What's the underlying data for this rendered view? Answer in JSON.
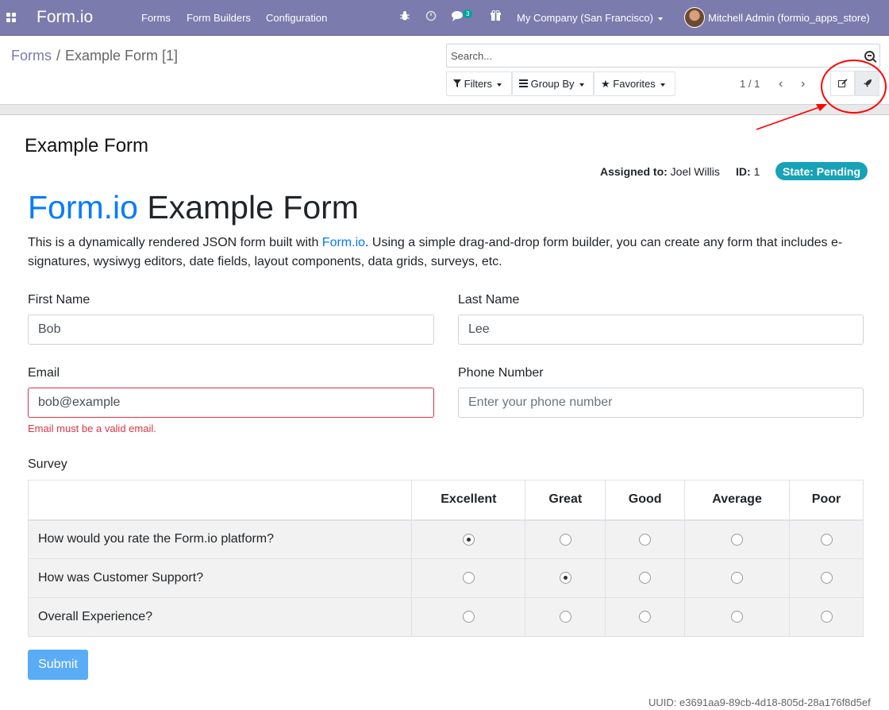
{
  "navbar": {
    "brand": "Form.io",
    "menu": [
      "Forms",
      "Form Builders",
      "Configuration"
    ],
    "messages_count": "3",
    "company": "My Company (San Francisco)",
    "user": "Mitchell Admin (formio_apps_store)",
    "bg_color": "#7c7bad"
  },
  "control_panel": {
    "breadcrumb": {
      "parent": "Forms",
      "current": "Example Form [1]"
    },
    "search": {
      "placeholder": "Search..."
    },
    "filters_label": "Filters",
    "groupby_label": "Group By",
    "favorites_label": "Favorites",
    "pager": "1 / 1"
  },
  "record": {
    "title": "Example Form",
    "assigned_label": "Assigned to:",
    "assigned_value": "Joel Willis",
    "id_label": "ID:",
    "id_value": "1",
    "state": "State: Pending",
    "state_color": "#17a2b8"
  },
  "form": {
    "heading_brand": "Form.io",
    "heading_rest": "Example Form",
    "intro_before": "This is a dynamically rendered JSON form built with ",
    "intro_link": "Form.io",
    "intro_after": ". Using a simple drag-and-drop form builder, you can create any form that includes e-signatures, wysiwyg editors, date fields, layout components, data grids, surveys, etc.",
    "first_name": {
      "label": "First Name",
      "value": "Bob"
    },
    "last_name": {
      "label": "Last Name",
      "value": "Lee"
    },
    "email": {
      "label": "Email",
      "value": "bob@example",
      "error": "Email must be a valid email."
    },
    "phone": {
      "label": "Phone Number",
      "placeholder": "Enter your phone number"
    },
    "survey": {
      "label": "Survey",
      "columns": [
        "Excellent",
        "Great",
        "Good",
        "Average",
        "Poor"
      ],
      "rows": [
        {
          "question": "How would you rate the Form.io platform?",
          "selected": "Excellent"
        },
        {
          "question": "How was Customer Support?",
          "selected": "Great"
        },
        {
          "question": "Overall Experience?",
          "selected": ""
        }
      ]
    },
    "submit_label": "Submit",
    "uuid": "UUID: e3691aa9-89cb-4d18-805d-28a176f8d5ef"
  }
}
